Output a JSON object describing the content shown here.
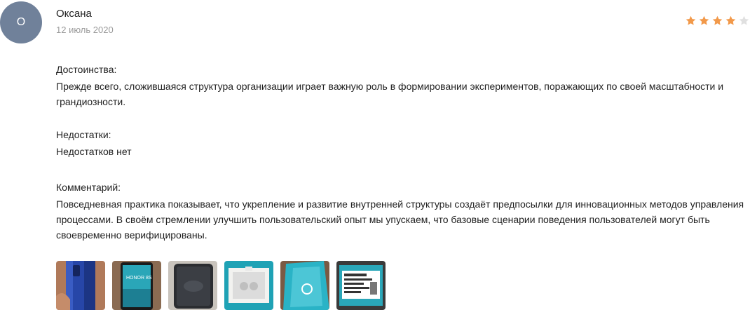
{
  "review": {
    "avatar_letter": "О",
    "author": "Оксана",
    "date": "12 июль 2020",
    "rating": 4,
    "rating_max": 5,
    "star_color_filled": "#f2994a",
    "star_color_empty": "#e0e0e0",
    "avatar_color": "#70819a"
  },
  "advantages": {
    "label": "Достоинства:",
    "text": "Прежде всего, сложившаяся структура организации играет важную роль в формировании экспериментов, поражающих по своей масштабности и грандиозности."
  },
  "disadvantages": {
    "label": "Недостатки:",
    "text": "Недостатков нет"
  },
  "comment": {
    "label": "Комментарий:",
    "text": "Повседневная практика показывает, что укрепление и развитие внутренней структуры создаёт предпосылки для инновационных методов управления процессами. В своём стремлении улучшить пользовательский опыт мы упускаем, что базовые сценарии поведения пользователей могут быть своевременно верифицированы."
  },
  "photos": [
    {
      "name": "photo-phone-back-blue"
    },
    {
      "name": "photo-phone-screen-honor"
    },
    {
      "name": "photo-phone-dark"
    },
    {
      "name": "photo-box-open"
    },
    {
      "name": "photo-box-side"
    },
    {
      "name": "photo-box-label"
    }
  ]
}
